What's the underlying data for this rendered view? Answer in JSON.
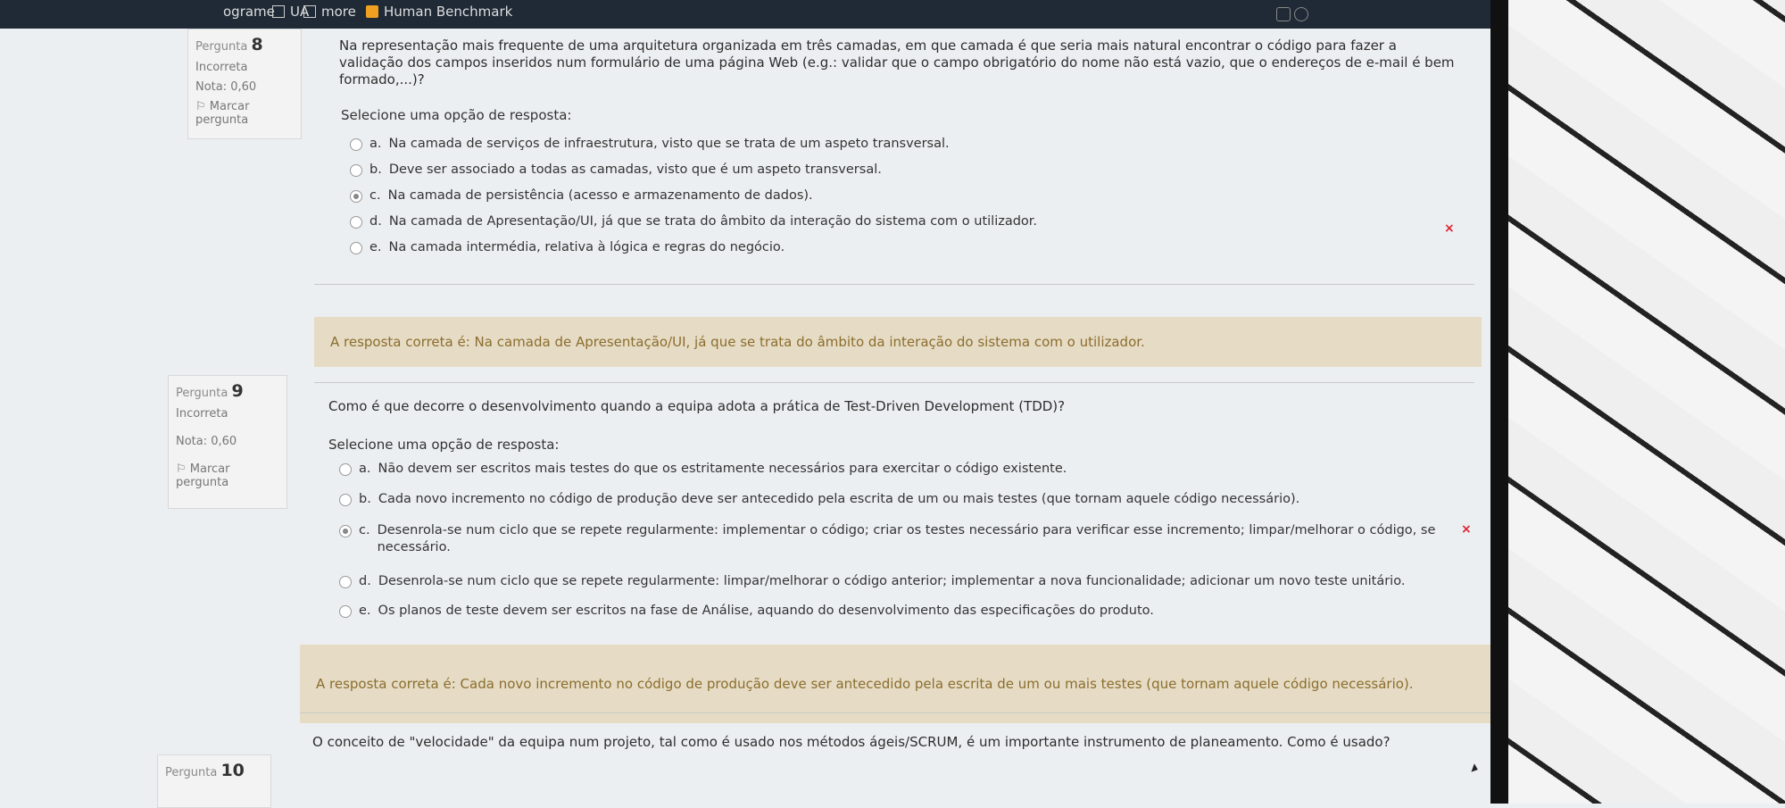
{
  "topbar": {
    "tab1": "ograme",
    "tab2": "UA",
    "tab3": "more",
    "tab4": "Human Benchmark"
  },
  "questions": [
    {
      "number_label": "Pergunta",
      "number": "8",
      "status": "Incorreta",
      "grade": "Nota: 0,60",
      "flag": "Marcar pergunta",
      "text": "Na representação mais frequente de uma arquitetura organizada em três camadas, em que camada é que seria mais natural encontrar o código para fazer a validação dos campos inseridos num formulário de uma página Web (e.g.: validar que o campo obrigatório do nome não está vazio, que o endereços de e-mail é bem formado,...)?",
      "prompt": "Selecione uma opção de resposta:",
      "options": [
        {
          "letter": "a.",
          "text": "Na camada de serviços de infraestrutura, visto que se trata de um aspeto transversal."
        },
        {
          "letter": "b.",
          "text": "Deve ser associado a todas as camadas, visto que é um aspeto transversal."
        },
        {
          "letter": "c.",
          "text": "Na camada de persistência (acesso e armazenamento de dados)."
        },
        {
          "letter": "d.",
          "text": "Na camada de Apresentação/UI, já que se trata do âmbito da interação do sistema com o utilizador."
        },
        {
          "letter": "e.",
          "text": "Na camada intermédia, relativa à lógica e regras do negócio."
        }
      ],
      "feedback": "A resposta correta é: Na camada de Apresentação/UI, já que se trata do âmbito da interação do sistema com o utilizador."
    },
    {
      "number_label": "Pergunta",
      "number": "9",
      "status": "Incorreta",
      "grade": "Nota: 0,60",
      "flag": "Marcar pergunta",
      "text": "Como é que decorre o desenvolvimento quando a equipa adota a prática de Test-Driven Development (TDD)?",
      "prompt": "Selecione uma opção de resposta:",
      "options": [
        {
          "letter": "a.",
          "text": "Não devem ser escritos mais testes do que os estritamente necessários para exercitar o código existente."
        },
        {
          "letter": "b.",
          "text": "Cada novo incremento no código de produção deve ser antecedido pela escrita de um ou mais testes (que tornam aquele código necessário)."
        },
        {
          "letter": "c.",
          "text": "Desenrola-se num ciclo que se repete regularmente: implementar o código; criar os testes necessário para verificar esse incremento; limpar/melhorar o código, se necessário."
        },
        {
          "letter": "d.",
          "text": "Desenrola-se num ciclo que se repete regularmente: limpar/melhorar o código anterior; implementar a nova funcionalidade; adicionar um novo teste unitário."
        },
        {
          "letter": "e.",
          "text": "Os planos de teste devem ser escritos na fase de Análise, aquando do desenvolvimento das especificações do produto."
        }
      ],
      "feedback": "A resposta correta é: Cada novo incremento no código de produção deve ser antecedido pela escrita de um ou mais testes (que tornam aquele código necessário)."
    },
    {
      "number_label": "Pergunta",
      "number": "10",
      "text": "O conceito de \"velocidade\" da equipa num projeto, tal como é usado nos métodos ágeis/SCRUM, é um importante instrumento de planeamento. Como é usado?"
    }
  ],
  "icons": {
    "wrong_mark": "×"
  }
}
